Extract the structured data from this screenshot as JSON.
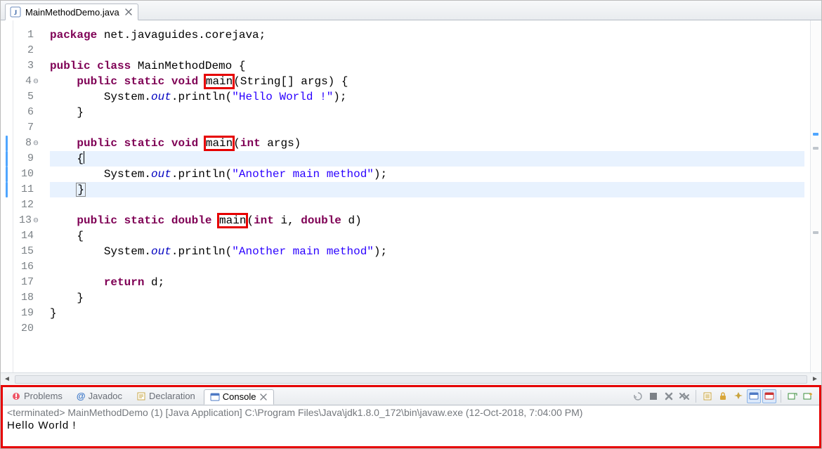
{
  "tab": {
    "file_name": "MainMethodDemo.java"
  },
  "gutter": {
    "lines": [
      {
        "num": "1"
      },
      {
        "num": "2"
      },
      {
        "num": "3"
      },
      {
        "num": "4",
        "fold": "⊖"
      },
      {
        "num": "5"
      },
      {
        "num": "6"
      },
      {
        "num": "7"
      },
      {
        "num": "8",
        "fold": "⊖"
      },
      {
        "num": "9"
      },
      {
        "num": "10"
      },
      {
        "num": "11"
      },
      {
        "num": "12"
      },
      {
        "num": "13",
        "fold": "⊖"
      },
      {
        "num": "14"
      },
      {
        "num": "15"
      },
      {
        "num": "16"
      },
      {
        "num": "17"
      },
      {
        "num": "18"
      },
      {
        "num": "19"
      },
      {
        "num": "20"
      }
    ]
  },
  "code": {
    "l1": {
      "kw_package": "package",
      "pkg": " net.javaguides.corejava;"
    },
    "l3": {
      "kw_public": "public",
      "kw_class": "class",
      "class_name": " MainMethodDemo ",
      "brace": "{"
    },
    "l4": {
      "indent": "    ",
      "kw_public": "public",
      "kw_static": " static",
      "kw_void": " void ",
      "method": "main",
      "params": "(String[] args) {"
    },
    "l5": {
      "indent": "        ",
      "call_pre": "System.",
      "out": "out",
      "call_post": ".println(",
      "str": "\"Hello World !\"",
      "end": ");"
    },
    "l6": {
      "indent": "    ",
      "brace": "}"
    },
    "l8": {
      "indent": "    ",
      "kw_public": "public",
      "kw_static": " static",
      "kw_void": " void ",
      "method": "main",
      "params": "(",
      "kw_int": "int",
      "params2": " args)"
    },
    "l9": {
      "indent": "    ",
      "brace_open_caret": "{"
    },
    "l10": {
      "indent": "        ",
      "call_pre": "System.",
      "out": "out",
      "call_post": ".println(",
      "str": "\"Another main method\"",
      "end": ");"
    },
    "l11": {
      "indent": "    ",
      "brace_close_box": "}"
    },
    "l13": {
      "indent": "    ",
      "kw_public": "public",
      "kw_static": " static",
      "kw_double": " double ",
      "method": "main",
      "params_open": "(",
      "kw_int": "int",
      "params_mid": " i, ",
      "kw_double2": "double",
      "params_end": " d)"
    },
    "l14": {
      "indent": "    ",
      "brace": "{"
    },
    "l15": {
      "indent": "        ",
      "call_pre": "System.",
      "out": "out",
      "call_post": ".println(",
      "str": "\"Another main method\"",
      "end": ");"
    },
    "l17": {
      "indent": "        ",
      "kw_return": "return",
      "rest": " d;"
    },
    "l18": {
      "indent": "    ",
      "brace": "}"
    },
    "l19": {
      "brace": "}"
    }
  },
  "views": {
    "problems": "Problems",
    "javadoc": "Javadoc",
    "declaration": "Declaration",
    "console": "Console"
  },
  "console": {
    "header": "<terminated> MainMethodDemo (1) [Java Application] C:\\Program Files\\Java\\jdk1.8.0_172\\bin\\javaw.exe (12-Oct-2018, 7:04:00 PM)",
    "output": "Hello World !"
  }
}
